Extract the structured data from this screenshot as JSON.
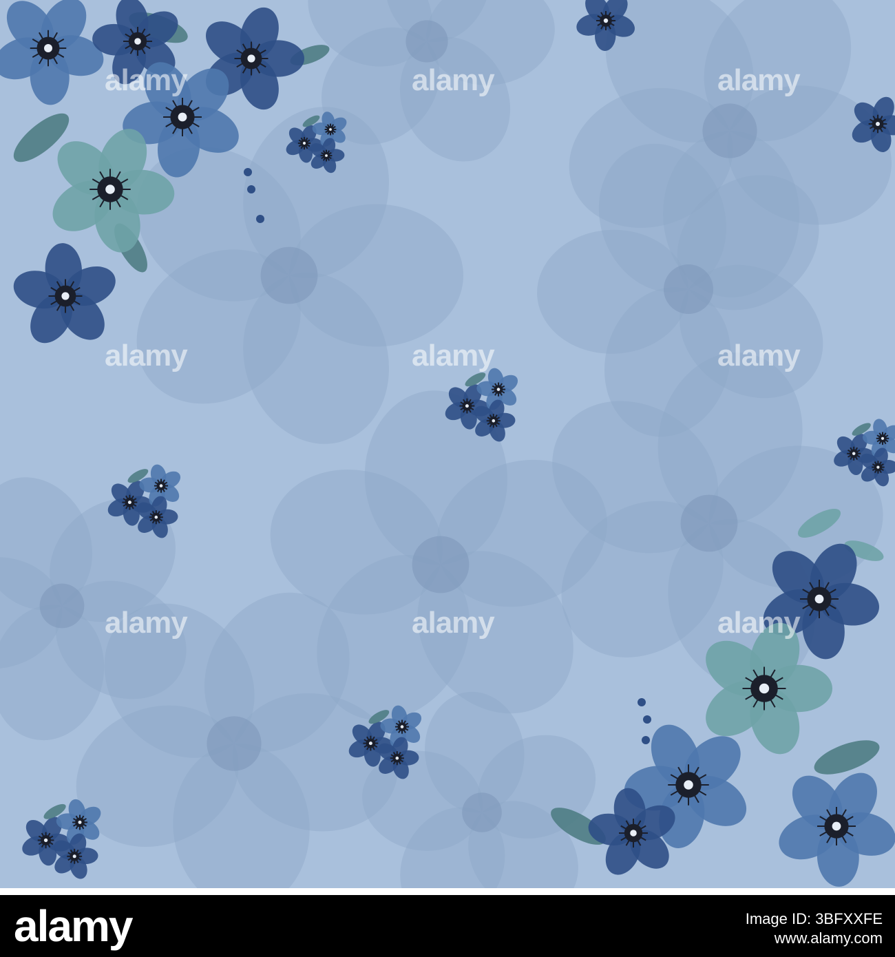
{
  "watermark": {
    "text": "alamy"
  },
  "footer": {
    "logo": "alamy",
    "image_id_label": "Image ID: 3BFXXFE",
    "site": "www.alamy.com"
  },
  "colors": {
    "background": "#a9c0dc",
    "ghost_petal": "#8ea8c8",
    "deep_blue": "#2f4f86",
    "mid_blue": "#4f78ad",
    "teal_green": "#6fa3a7",
    "leaf_green": "#4f7d84",
    "stamen": "#1b1f2b",
    "footer_bg": "#000000"
  }
}
